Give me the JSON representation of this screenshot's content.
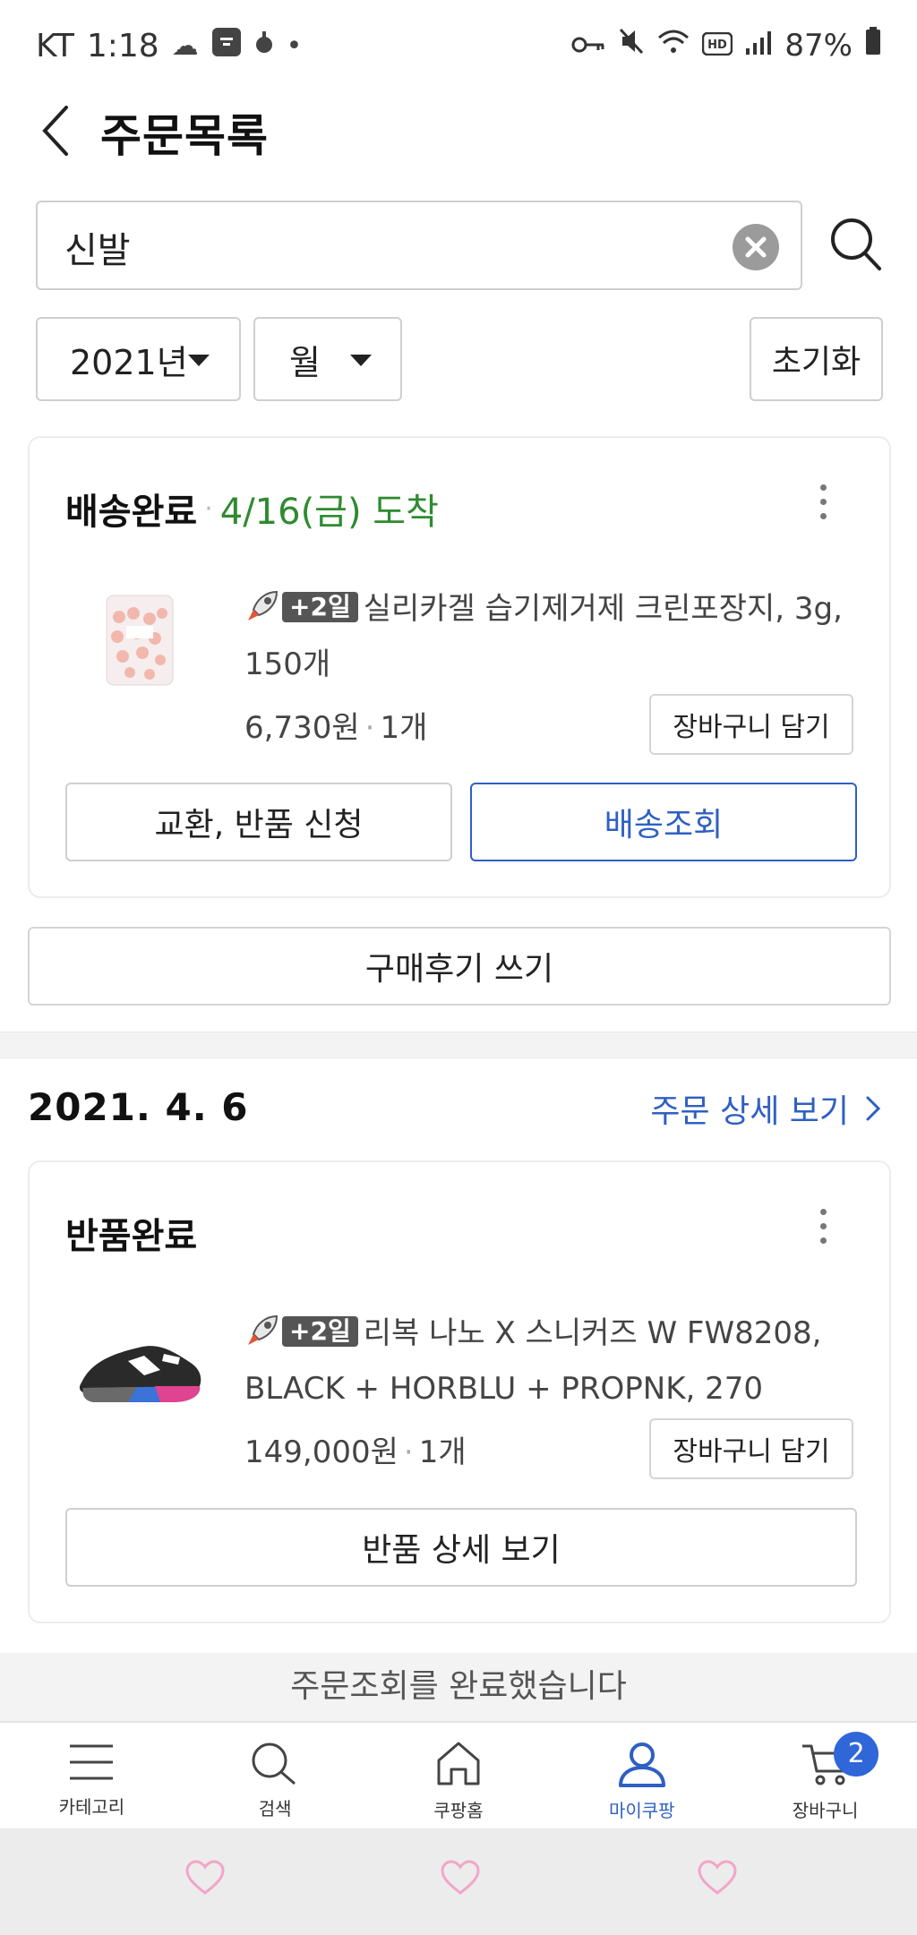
{
  "status_bar": {
    "carrier": "KT",
    "time": "1:18",
    "battery": "87%",
    "icons_left": [
      "weather-icon",
      "app-icon",
      "notification-icon",
      "dot-icon"
    ],
    "icons_right": [
      "key-icon",
      "mute-icon",
      "wifi-icon",
      "hd-icon",
      "signal-icon",
      "battery-icon"
    ]
  },
  "header": {
    "title": "주문목록"
  },
  "search": {
    "value": "신발"
  },
  "filters": {
    "year": "2021년",
    "month": "월",
    "reset": "초기화"
  },
  "orders": [
    {
      "status": "배송완료",
      "delivery_date": "4/16(금) 도착",
      "product": {
        "badge": "+2일",
        "name": "실리카겔 습기제거제 크린포장지, 3g, 150개",
        "price": "6,730원",
        "qty": "1개",
        "image": "silica-gel-pack"
      },
      "cart_button": "장바구니 담기",
      "actions": [
        "교환, 반품 신청",
        "배송조회"
      ],
      "review_button": "구매후기 쓰기"
    },
    {
      "order_date": "2021. 4. 6",
      "detail_link": "주문 상세 보기",
      "status": "반품완료",
      "product": {
        "badge": "+2일",
        "name": "리복 나노 X 스니커즈 W FW8208, BLACK + HORBLU + PROPNK, 270",
        "price": "149,000원",
        "qty": "1개",
        "image": "sneaker"
      },
      "cart_button": "장바구니 담기",
      "actions": [
        "반품 상세 보기"
      ]
    }
  ],
  "notice": "주문조회를 완료했습니다",
  "bottom_nav": {
    "items": [
      {
        "label": "카테고리",
        "icon": "menu-icon"
      },
      {
        "label": "검색",
        "icon": "search-icon"
      },
      {
        "label": "쿠팡홈",
        "icon": "home-icon"
      },
      {
        "label": "마이쿠팡",
        "icon": "user-icon",
        "active": true
      },
      {
        "label": "장바구니",
        "icon": "cart-icon",
        "badge": "2"
      }
    ]
  },
  "colors": {
    "accent_blue": "#2f5fc2",
    "delivered_green": "#2e8b2e"
  }
}
